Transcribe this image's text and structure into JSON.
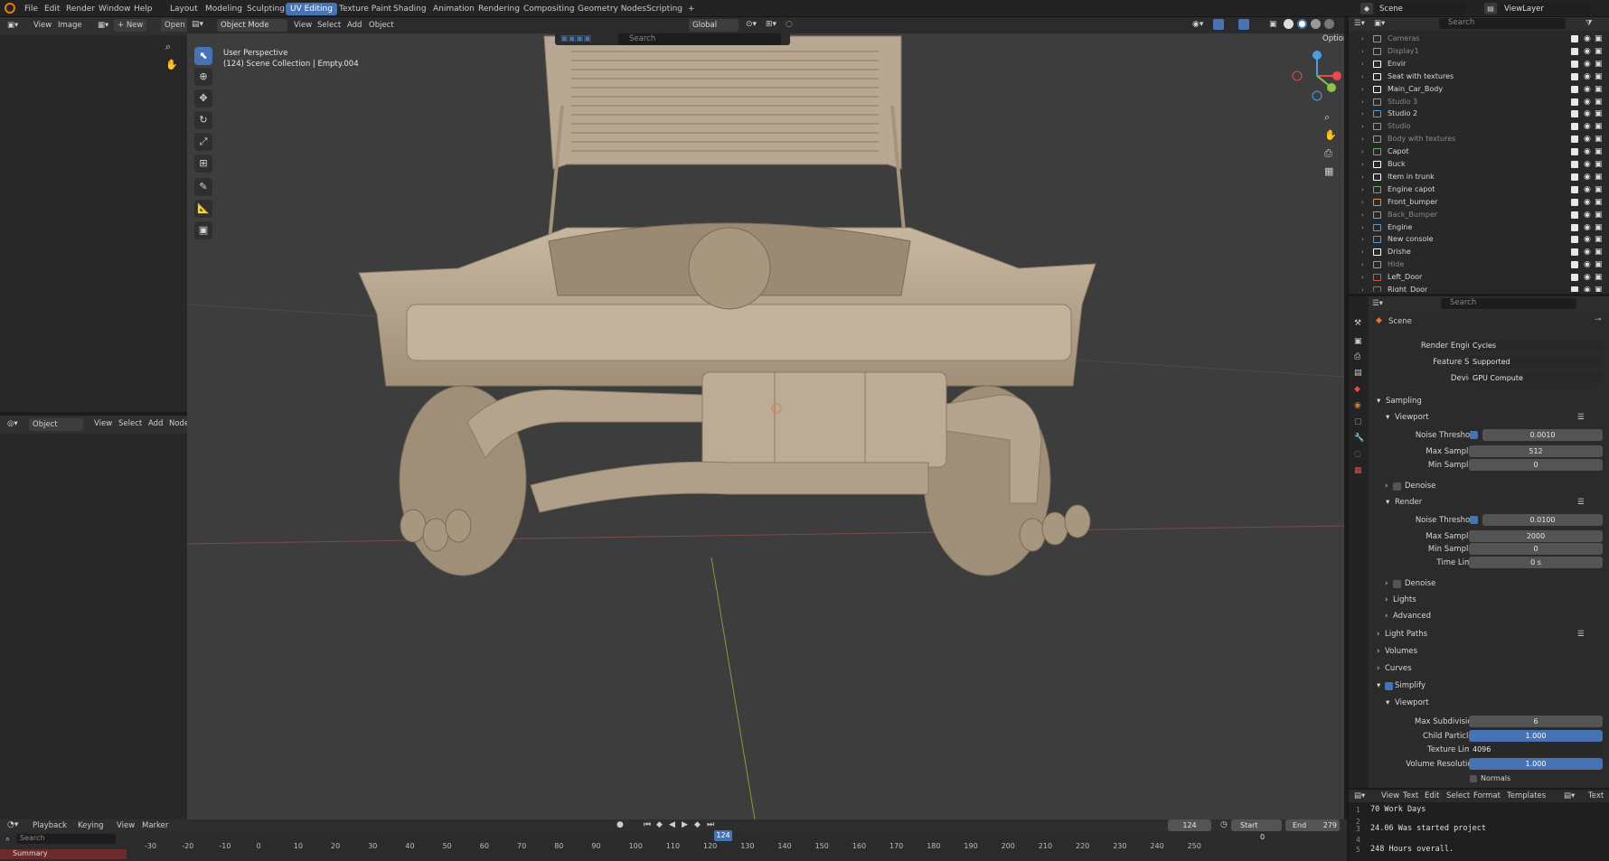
{
  "topbar": {
    "menus": [
      "File",
      "Edit",
      "Render",
      "Window",
      "Help"
    ],
    "workspaces": [
      "Layout",
      "Modeling",
      "Sculpting",
      "UV Editing",
      "Texture Paint",
      "Shading",
      "Animation",
      "Rendering",
      "Compositing",
      "Geometry Nodes",
      "Scripting"
    ],
    "active_workspace": "UV Editing",
    "add_tab": "+",
    "scene": "Scene",
    "view_layer": "ViewLayer"
  },
  "image_editor": {
    "menus": [
      "View",
      "Image"
    ],
    "new_btn": "+ New",
    "open_btn": "Open"
  },
  "node_editor": {
    "object_dropdown": "Object",
    "menus": [
      "View",
      "Select",
      "Add",
      "Node"
    ]
  },
  "viewport_header": {
    "mode": "Object Mode",
    "menus": [
      "View",
      "Select",
      "Add",
      "Object"
    ],
    "orientation": "Global",
    "search_placeholder": "Search",
    "options": "Options"
  },
  "viewport": {
    "perspective": "User Perspective",
    "collection": "(124) Scene Collection | Empty.004"
  },
  "outliner": {
    "search_placeholder": "Search",
    "items": [
      {
        "label": "Cameras",
        "color": "#9a9a9a",
        "disabled": true
      },
      {
        "label": "Display1",
        "color": "#9a9a9a",
        "disabled": true
      },
      {
        "label": "Envir",
        "color": "#ffffff",
        "disabled": false
      },
      {
        "label": "Seat with textures",
        "color": "#ffffff",
        "disabled": false
      },
      {
        "label": "Main_Car_Body",
        "color": "#ffffff",
        "disabled": false
      },
      {
        "label": "Studio 3",
        "color": "#9a9a9a",
        "disabled": true
      },
      {
        "label": "Studio 2",
        "color": "#4a9fe3",
        "disabled": false
      },
      {
        "label": "Studio",
        "color": "#9a9a9a",
        "disabled": true
      },
      {
        "label": "Body with textures",
        "color": "#9a9a9a",
        "disabled": true
      },
      {
        "label": "Capot",
        "color": "#62b35c",
        "disabled": false
      },
      {
        "label": "Buck",
        "color": "#ffffff",
        "disabled": false
      },
      {
        "label": "Item in trunk",
        "color": "#ffffff",
        "disabled": false
      },
      {
        "label": "Engine capot",
        "color": "#62b35c",
        "disabled": false
      },
      {
        "label": "Front_bumper",
        "color": "#e88a3a",
        "disabled": false
      },
      {
        "label": "Back_Bumper",
        "color": "#9a9a9a",
        "disabled": true
      },
      {
        "label": "Engine",
        "color": "#4a9fe3",
        "disabled": false
      },
      {
        "label": "New console",
        "color": "#4a9fe3",
        "disabled": false
      },
      {
        "label": "Drishe",
        "color": "#ffffff",
        "disabled": false
      },
      {
        "label": "Hide",
        "color": "#9a9a9a",
        "disabled": true
      },
      {
        "label": "Left_Door",
        "color": "#e84a4a",
        "disabled": false
      },
      {
        "label": "Right_Door",
        "color": "#e84a4a",
        "disabled": false
      }
    ]
  },
  "properties": {
    "search_placeholder": "Search",
    "scene_label": "Scene",
    "render_engine_label": "Render Engine",
    "render_engine": "Cycles",
    "feature_set_label": "Feature Set",
    "feature_set": "Supported",
    "device_label": "Device",
    "device": "GPU Compute",
    "sampling": "Sampling",
    "viewport": "Viewport",
    "noise_threshold_label": "Noise Threshold",
    "vp_noise_threshold": "0.0010",
    "max_samples_label": "Max Samples",
    "vp_max_samples": "512",
    "min_samples_label": "Min Samples",
    "vp_min_samples": "0",
    "denoise": "Denoise",
    "render": "Render",
    "r_noise_threshold": "0.0100",
    "r_max_samples": "2000",
    "r_min_samples": "0",
    "time_limit_label": "Time Limit",
    "time_limit": "0 s",
    "lights": "Lights",
    "advanced": "Advanced",
    "light_paths": "Light Paths",
    "volumes": "Volumes",
    "curves": "Curves",
    "simplify": "Simplify",
    "simplify_viewport": "Viewport",
    "max_subdivision_label": "Max Subdivision",
    "max_subdivision": "6",
    "child_particles_label": "Child Particles",
    "child_particles": "1.000",
    "texture_limit_label": "Texture Limit",
    "texture_limit": "4096",
    "volume_resolution_label": "Volume Resolution",
    "volume_resolution": "1.000",
    "normals": "Normals"
  },
  "text_editor": {
    "menus": [
      "View",
      "Text",
      "Edit",
      "Select",
      "Format",
      "Templates"
    ],
    "text_label": "Text",
    "lines": [
      {
        "no": "1",
        "text": "70 Work Days"
      },
      {
        "no": "2",
        "text": ""
      },
      {
        "no": "3",
        "text": "24.06 Was started project"
      },
      {
        "no": "4",
        "text": ""
      },
      {
        "no": "5",
        "text": "248 Hours overall."
      }
    ]
  },
  "timeline": {
    "menus": [
      "Playback",
      "Keying",
      "View",
      "Marker"
    ],
    "current_frame": "124",
    "start_label": "Start",
    "start": "0",
    "end_label": "End",
    "end": "279",
    "ticks": [
      "-30",
      "-20",
      "-10",
      "0",
      "10",
      "20",
      "30",
      "40",
      "50",
      "60",
      "70",
      "80",
      "90",
      "100",
      "110",
      "120",
      "130",
      "140",
      "150",
      "160",
      "170",
      "180",
      "190",
      "200",
      "210",
      "220",
      "230",
      "240",
      "250"
    ],
    "search_placeholder": "Search",
    "summary": "Summary"
  }
}
